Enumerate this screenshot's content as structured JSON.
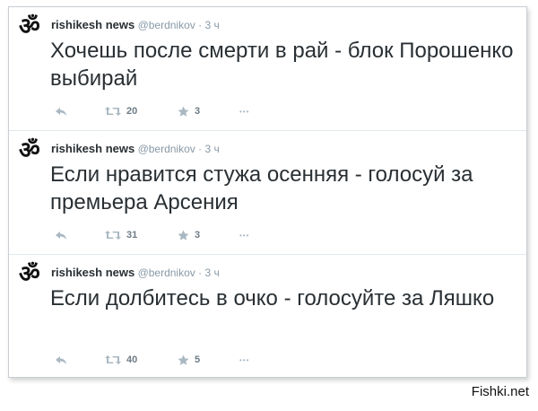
{
  "tweets": [
    {
      "name": "rishikesh news",
      "handle": "@berdnikov",
      "dot": "·",
      "time": "3 ч",
      "text": "Хочешь после смерти в рай - блок Порошенко выбирай",
      "retweets": "20",
      "favorites": "3"
    },
    {
      "name": "rishikesh news",
      "handle": "@berdnikov",
      "dot": "·",
      "time": "3 ч",
      "text": "Если нравится стужа осенняя - голосуй за премьера Арсения",
      "retweets": "31",
      "favorites": "3"
    },
    {
      "name": "rishikesh news",
      "handle": "@berdnikov",
      "dot": "·",
      "time": "3 ч",
      "text": "Если долбитесь в очко - голосуйте за Ляшко",
      "retweets": "40",
      "favorites": "5"
    }
  ],
  "avatar_glyph": "ॐ",
  "more_glyph": "•••",
  "watermark": "Fishki.net",
  "icons": [
    "reply-icon",
    "retweet-icon",
    "favorite-star-icon",
    "more-icon",
    "om-avatar-icon"
  ],
  "colors": {
    "text": "#292f33",
    "meta": "#8899a6",
    "divider": "#e1e8ed"
  }
}
